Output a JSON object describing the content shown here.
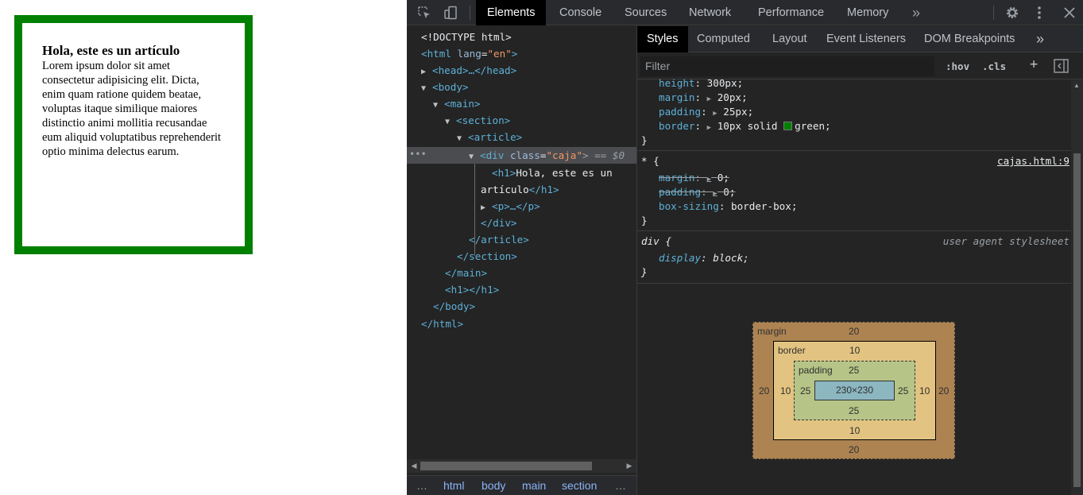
{
  "page": {
    "heading": "Hola, este es un artículo",
    "paragraph": "Lorem ipsum dolor sit amet consectetur adipisicing elit. Dicta, enim quam ratione quidem beatae, voluptas itaque similique maiores distinctio animi mollitia recusandae eum aliquid voluptatibus reprehenderit optio minima delectus earum."
  },
  "devtools": {
    "tabs": [
      "Elements",
      "Console",
      "Sources",
      "Network",
      "Performance",
      "Memory"
    ],
    "more_tabs": "»",
    "icons": [
      "inspect-element-icon",
      "device-toolbar-icon",
      "settings-gear-icon",
      "kebab-menu-icon",
      "close-icon"
    ],
    "tree": {
      "doctype": "<!DOCTYPE html>",
      "html_open": "<html",
      "html_attr": "lang",
      "html_val": "\"en\"",
      "head": "<head>…</head>",
      "body_open": "<body>",
      "main_open": "<main>",
      "section_open": "<section>",
      "article_open": "<article>",
      "div_tag": "<div",
      "div_attr": "class",
      "div_val": "\"caja\"",
      "div_tail": "> == $0",
      "h1_open": "<h1>",
      "h1_text_1": "Hola, este es un",
      "h1_text_2": "artículo",
      "h1_close": "</h1>",
      "p_collapsed": "<p>…</p>",
      "div_close": "</div>",
      "article_close": "</article>",
      "section_close": "</section>",
      "main_close": "</main>",
      "h1_empty": "<h1></h1>",
      "body_close": "</body>",
      "html_close": "</html>",
      "row_dots": "•••"
    },
    "breadcrumbs": [
      "html",
      "body",
      "main",
      "section"
    ],
    "breadcrumb_ellipsis": "…",
    "styles": {
      "subtabs": [
        "Styles",
        "Computed",
        "Layout",
        "Event Listeners",
        "DOM Breakpoints"
      ],
      "subtabs_more": "»",
      "filter_placeholder": "Filter",
      "hov": ":hov",
      "cls": ".cls",
      "plus": "+",
      "rule1": {
        "decls": [
          {
            "prop": "height",
            "value": "300px;"
          },
          {
            "prop": "margin",
            "value": "20px;"
          },
          {
            "prop": "padding",
            "value": "25px;"
          },
          {
            "prop": "border",
            "value": "10px solid",
            "color": "green",
            "color_hex": "#008000"
          }
        ],
        "close": "}"
      },
      "rule2": {
        "selector": "* {",
        "source": "cajas.html:9",
        "decls": [
          {
            "prop": "margin",
            "value": "0;",
            "overridden": true
          },
          {
            "prop": "padding",
            "value": "0;",
            "overridden": true
          },
          {
            "prop": "box-sizing",
            "value": "border-box;"
          }
        ],
        "close": "}"
      },
      "rule3": {
        "selector": "div {",
        "source": "user agent stylesheet",
        "decls": [
          {
            "prop": "display",
            "value": "block;"
          }
        ],
        "close": "}"
      }
    },
    "box_model": {
      "margin_label": "margin",
      "margin": "20",
      "border_label": "border",
      "border": "10",
      "padding_label": "padding",
      "padding": "25",
      "content": "230×230"
    }
  }
}
